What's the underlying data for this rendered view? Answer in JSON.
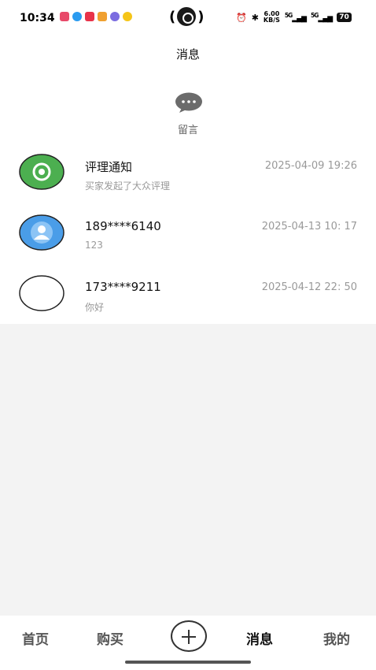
{
  "status_bar": {
    "time": "10:34",
    "network_speed": "6.00",
    "network_unit": "KB/S",
    "signal_1": "5G",
    "signal_2": "5G",
    "battery": "70"
  },
  "header": {
    "title": "消息"
  },
  "guestbook": {
    "label": "留言",
    "icon": "chat-bubble-icon"
  },
  "messages": [
    {
      "title": "评理通知",
      "subtitle": "买家发起了大众评理",
      "time": "2025-04-09 19:26",
      "avatar": "shutter-icon",
      "avatar_color": "#4caf50"
    },
    {
      "title": "189****6140",
      "subtitle": "123",
      "time": "2025-04-13 10: 17",
      "avatar": "user-icon",
      "avatar_color": "#4a9de8"
    },
    {
      "title": "173****9211",
      "subtitle": "你好",
      "time": "2025-04-12 22: 50",
      "avatar": "empty",
      "avatar_color": "#ffffff"
    }
  ],
  "tabbar": {
    "home": "首页",
    "buy": "购买",
    "messages": "消息",
    "mine": "我的",
    "active": "messages"
  }
}
